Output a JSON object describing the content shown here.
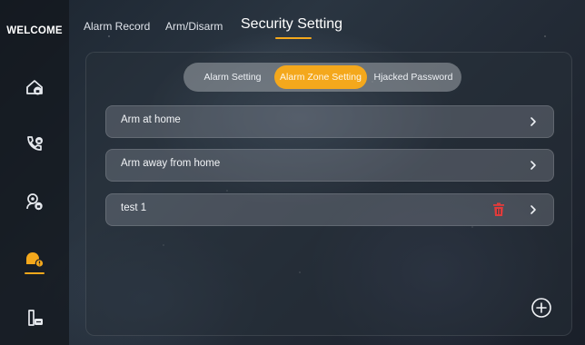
{
  "sidebar": {
    "welcome": "WELCOME",
    "items": [
      {
        "icon": "home-lock-icon"
      },
      {
        "icon": "phone-lock-icon"
      },
      {
        "icon": "intercom-lock-icon"
      },
      {
        "icon": "alarm-security-icon",
        "active": true
      },
      {
        "icon": "keypad-phone-icon"
      }
    ]
  },
  "header": {
    "tabs": [
      {
        "label": "Alarm Record"
      },
      {
        "label": "Arm/Disarm"
      },
      {
        "label": "Security Setting",
        "active": true
      }
    ]
  },
  "segment": {
    "options": [
      {
        "label": "Alarm Setting"
      },
      {
        "label": "Alarm Zone Setting",
        "selected": true
      },
      {
        "label": "Hjacked Password"
      }
    ]
  },
  "zones": [
    {
      "label": "Arm at home"
    },
    {
      "label": "Arm away from home"
    },
    {
      "label": "test 1",
      "deletable": true
    }
  ],
  "colors": {
    "accent": "#f4a81c",
    "delete": "#e23b3b"
  }
}
